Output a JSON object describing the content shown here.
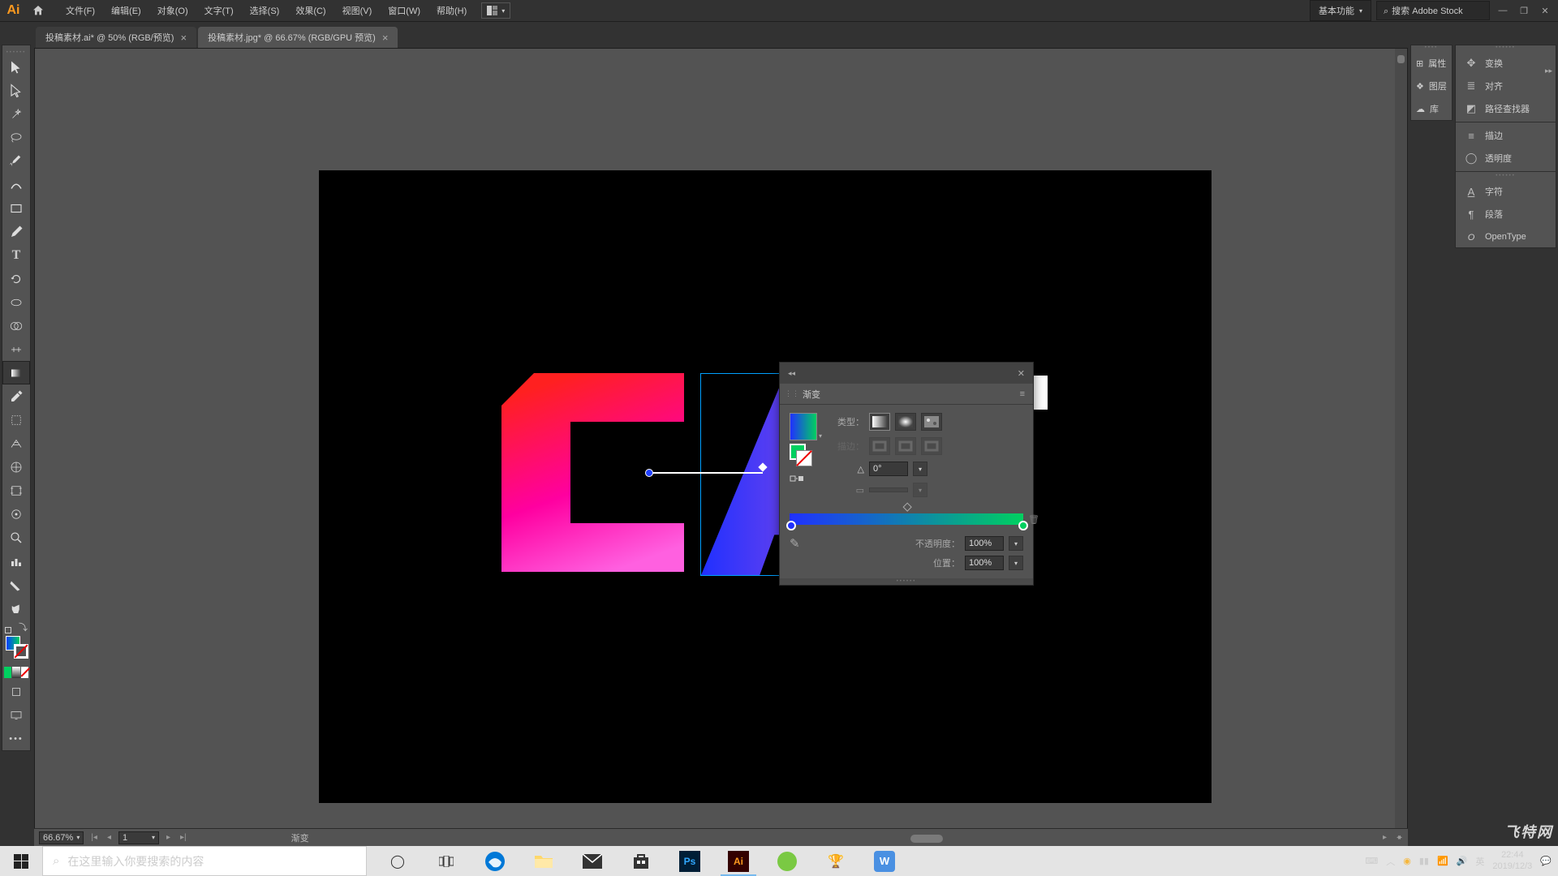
{
  "app": {
    "logo": "Ai"
  },
  "menubar": {
    "items": [
      "文件(F)",
      "编辑(E)",
      "对象(O)",
      "文字(T)",
      "选择(S)",
      "效果(C)",
      "视图(V)",
      "窗口(W)",
      "帮助(H)"
    ],
    "workspace": "基本功能",
    "search_placeholder": "搜索 Adobe Stock"
  },
  "tabs": [
    {
      "label": "投稿素材.ai* @ 50% (RGB/预览)",
      "active": false
    },
    {
      "label": "投稿素材.jpg* @ 66.67% (RGB/GPU 预览)",
      "active": true
    }
  ],
  "right_panel": {
    "group1": [
      {
        "icon": "❖",
        "label": "变换"
      },
      {
        "icon": "≣",
        "label": "对齐"
      },
      {
        "icon": "◩",
        "label": "路径查找器"
      }
    ],
    "group2": [
      {
        "icon": "≡",
        "label": "描边"
      },
      {
        "icon": "◯",
        "label": "透明度"
      }
    ],
    "group3": [
      {
        "icon": "A",
        "label": "字符"
      },
      {
        "icon": "¶",
        "label": "段落"
      },
      {
        "icon": "O",
        "label": "OpenType"
      }
    ]
  },
  "right_panel2": [
    {
      "icon": "⊞",
      "label": "属性"
    },
    {
      "icon": "❖",
      "label": "图层"
    },
    {
      "icon": "◉",
      "label": "库"
    }
  ],
  "gradient_panel": {
    "title": "渐变",
    "type_label": "类型：",
    "stroke_label": "描边：",
    "angle": "0°",
    "opacity_label": "不透明度：",
    "opacity": "100%",
    "location_label": "位置：",
    "location": "100%"
  },
  "statusbar": {
    "zoom": "66.67%",
    "artboard": "1",
    "tool_name": "渐变"
  },
  "taskbar": {
    "search_placeholder": "在这里输入你要搜索的内容",
    "time": "22:44",
    "date": "2019/12/3"
  },
  "watermark": "飞特网"
}
